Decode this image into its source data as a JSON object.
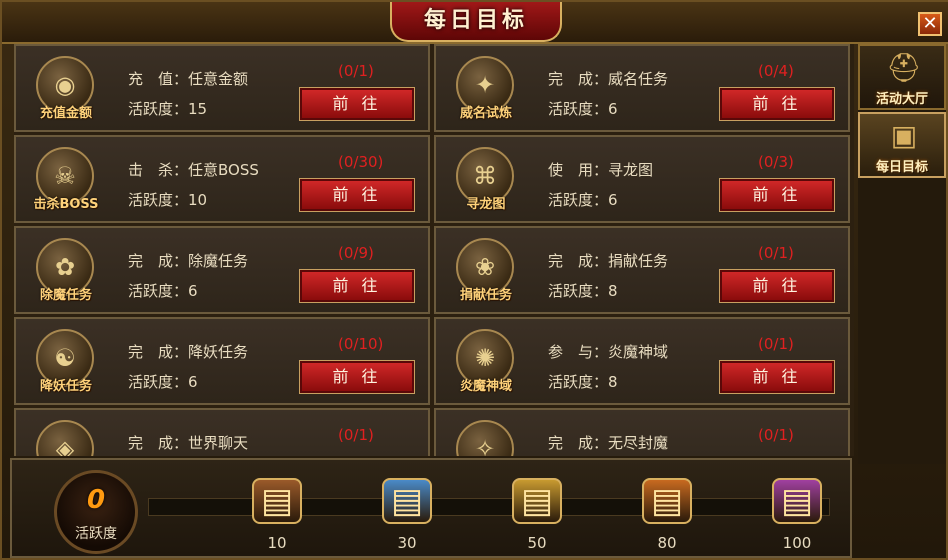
{
  "window": {
    "title": "每日目标",
    "close_icon": "close-icon"
  },
  "side_tabs": [
    {
      "label": "活动大厅",
      "icon": "helmet-icon"
    },
    {
      "label": "每日目标",
      "icon": "chest-icon"
    }
  ],
  "go_label": "前 往",
  "tasks": [
    {
      "icon_label": "充值金额",
      "task": "充　值：任意金额",
      "activity": "活跃度：15",
      "progress": "(0/1)"
    },
    {
      "icon_label": "威名试炼",
      "task": "完　成：威名任务",
      "activity": "活跃度：6",
      "progress": "(0/4)"
    },
    {
      "icon_label": "击杀BOSS",
      "task": "击　杀：任意BOSS",
      "activity": "活跃度：10",
      "progress": "(0/30)"
    },
    {
      "icon_label": "寻龙图",
      "task": "使　用：寻龙图",
      "activity": "活跃度：6",
      "progress": "(0/3)"
    },
    {
      "icon_label": "除魔任务",
      "task": "完　成：除魔任务",
      "activity": "活跃度：6",
      "progress": "(0/9)"
    },
    {
      "icon_label": "捐献任务",
      "task": "完　成：捐献任务",
      "activity": "活跃度：8",
      "progress": "(0/1)"
    },
    {
      "icon_label": "降妖任务",
      "task": "完　成：降妖任务",
      "activity": "活跃度：6",
      "progress": "(0/10)"
    },
    {
      "icon_label": "炎魔神域",
      "task": "参　与：炎魔神域",
      "activity": "活跃度：8",
      "progress": "(0/1)"
    },
    {
      "icon_label": "",
      "task": "完　成：世界聊天",
      "activity": "",
      "progress": "(0/1)"
    },
    {
      "icon_label": "",
      "task": "完　成：无尽封魔",
      "activity": "",
      "progress": "(0/1)"
    }
  ],
  "activity": {
    "value": "0",
    "label": "活跃度"
  },
  "rewards": [
    {
      "threshold": "10",
      "chest": "chest-bronze-icon",
      "color": "#9a5a2a"
    },
    {
      "threshold": "30",
      "chest": "chest-blue-icon",
      "color": "#4a8ac8"
    },
    {
      "threshold": "50",
      "chest": "chest-gold-blue-icon",
      "color": "#c89a30"
    },
    {
      "threshold": "80",
      "chest": "chest-gold-red-icon",
      "color": "#c86a20"
    },
    {
      "threshold": "100",
      "chest": "chest-purple-icon",
      "color": "#a040a0"
    }
  ]
}
